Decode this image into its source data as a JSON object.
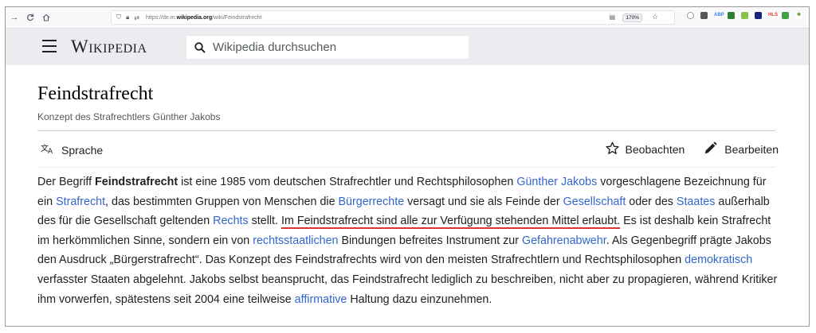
{
  "browser": {
    "url_prefix": "https://de.m.",
    "url_domain": "wikipedia.org",
    "url_path": "/wiki/Feindstrafrecht",
    "zoom": "170%",
    "extensions": [
      "ABP",
      "HLS"
    ]
  },
  "header": {
    "logo": "Wikipedia",
    "search_placeholder": "Wikipedia durchsuchen"
  },
  "article": {
    "title": "Feindstrafrecht",
    "subtitle": "Konzept des Strafrechtlers Günther Jakobs",
    "language_label": "Sprache",
    "watch_label": "Beobachten",
    "edit_label": "Bearbeiten",
    "p": {
      "t1": "Der Begriff ",
      "b1": "Feindstrafrecht",
      "t2": " ist eine 1985 vom deutschen Strafrechtler und Rechtsphilosophen ",
      "l1": "Günther Jakobs",
      "t3": " vorgeschlagene Bezeichnung für ein ",
      "l2": "Strafrecht",
      "t4": ", das bestimmten Gruppen von Menschen die ",
      "l3": "Bürgerrechte",
      "t5": " versagt und sie als Feinde der ",
      "l4": "Gesellschaft",
      "t6": " oder des ",
      "l5": "Staates",
      "t7": " außerhalb des für die Gesellschaft geltenden ",
      "l6": "Rechts",
      "t8": " stellt. ",
      "h1": "Im Feindstrafrecht sind alle zur Verfügung stehenden Mittel erlaubt.",
      "t9": " Es ist deshalb kein Strafrecht im herkömmlichen Sinne, sondern ein von ",
      "l7": "rechtsstaatlichen",
      "t10": " Bindungen befreites Instrument zur ",
      "l8": "Gefahrenabwehr",
      "t11": ". Als Gegenbegriff prägte Jakobs den Ausdruck „Bürgerstrafrecht“. Das Konzept des Feindstrafrechts wird von den meisten Strafrechtlern und Rechtsphilosophen ",
      "l9": "demokratisch",
      "t12": " verfasster Staaten abgelehnt. Jakobs selbst beansprucht, das Feindstrafrecht lediglich zu beschreiben, nicht aber zu propagieren, während Kritiker ihm vorwerfen, spätestens seit 2004 eine teilweise ",
      "l10": "affirmative",
      "t13": " Haltung dazu einzunehmen."
    }
  }
}
